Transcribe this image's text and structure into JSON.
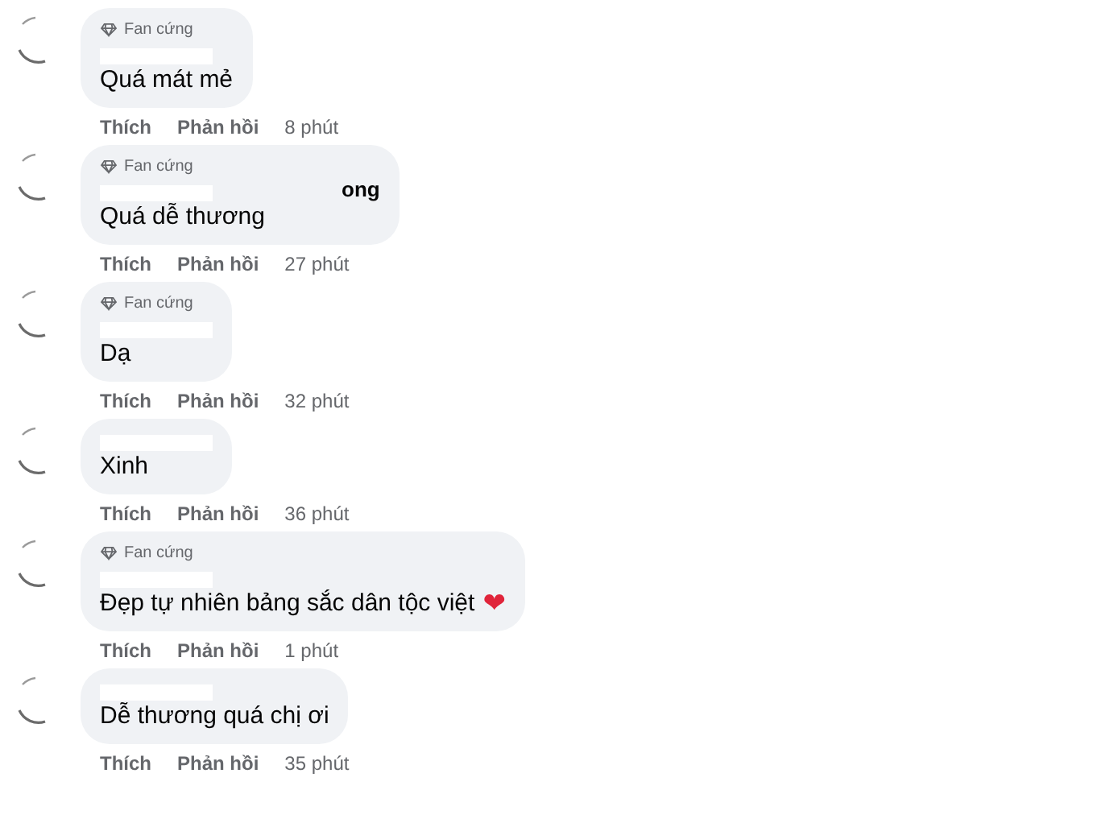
{
  "comments": [
    {
      "badge": "Fan cứng",
      "text": "Quá mát mẻ",
      "actions": [
        "Thích",
        "Phản hồi"
      ],
      "time": "8 phút"
    },
    {
      "badge": "Fan cứng",
      "name_fragment": "ong",
      "text": "Quá dễ thương",
      "actions": [
        "Thích",
        "Phản hồi"
      ],
      "time": "27 phút"
    },
    {
      "badge": "Fan cứng",
      "text": "Dạ",
      "actions": [
        "Thích",
        "Phản hồi"
      ],
      "time": "32 phút"
    },
    {
      "text": "Xinh",
      "actions": [
        "Thích",
        "Phản hồi"
      ],
      "time": "36 phút"
    },
    {
      "badge": "Fan cứng",
      "text": "Đẹp tự nhiên bảng sắc dân tộc việt",
      "emoji": "❤",
      "actions": [
        "Thích",
        "Phản hồi"
      ],
      "time": "1 phút"
    },
    {
      "text": "Dễ thương quá chị ơi",
      "actions": [
        "Thích",
        "Phản hồi"
      ],
      "time": "35 phút"
    }
  ]
}
